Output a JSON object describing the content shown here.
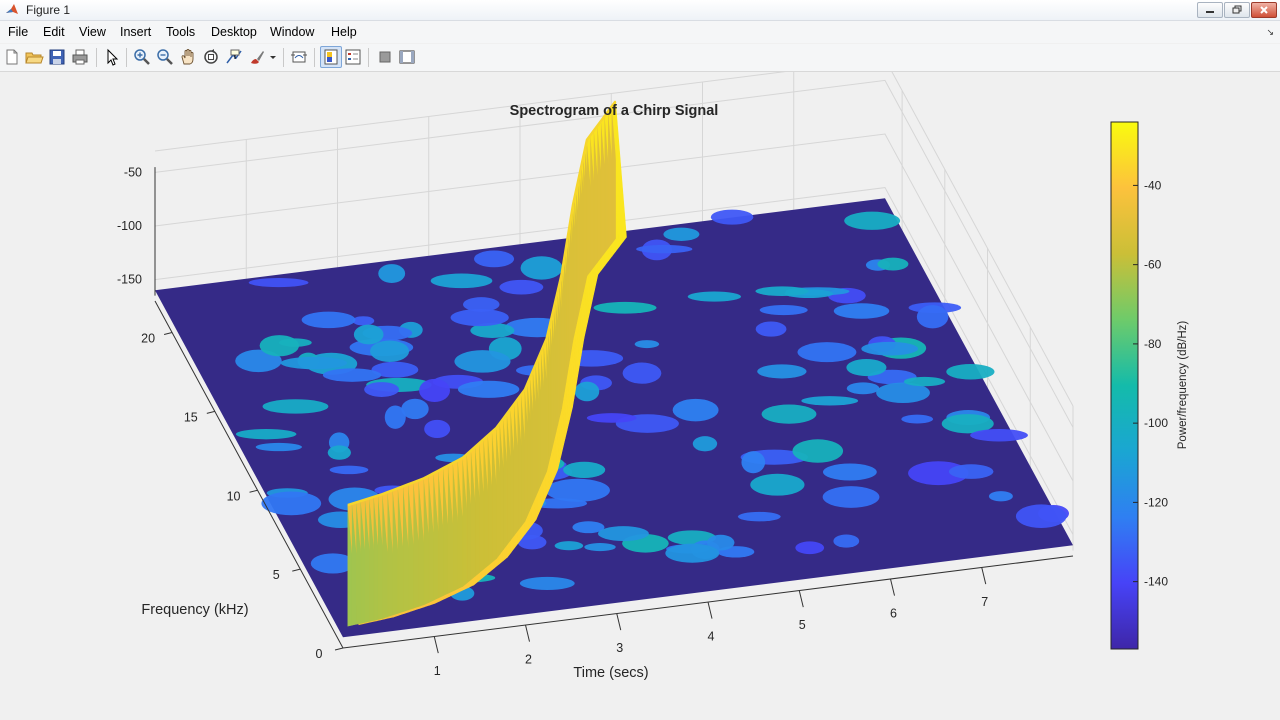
{
  "window": {
    "title": "Figure 1",
    "controls": [
      "minimize",
      "restore",
      "close"
    ]
  },
  "menu": [
    "File",
    "Edit",
    "View",
    "Insert",
    "Tools",
    "Desktop",
    "Window",
    "Help"
  ],
  "toolbar": [
    "new-figure",
    "open-file",
    "save-figure",
    "print-figure",
    "edit-plot",
    "zoom-in",
    "zoom-out",
    "pan",
    "rotate-3d",
    "data-cursor",
    "brush",
    "link-plot",
    "insert-colorbar",
    "insert-legend",
    "hide-plot-tools",
    "show-plot-tools"
  ],
  "colors": {
    "colormap": [
      "#3e26a8",
      "#4743f7",
      "#2f7ff2",
      "#1aa6d2",
      "#14bbaa",
      "#6ecb6a",
      "#cbbf37",
      "#fcc23c",
      "#f9fb0e"
    ],
    "surface_low": "#352a87",
    "ridge": "#f6d62d"
  },
  "chart_data": {
    "type": "surface",
    "title": "Spectrogram of a Chirp Signal",
    "xlabel": "Time (secs)",
    "ylabel": "Frequency (kHz)",
    "zlabel": "",
    "colorbar_label": "Power/frequency (dB/Hz)",
    "xlim": [
      0,
      8
    ],
    "ylim": [
      0,
      22
    ],
    "zlim": [
      -170,
      -30
    ],
    "xticks": [
      "1",
      "2",
      "3",
      "4",
      "5",
      "6",
      "7"
    ],
    "yticks": [
      "0",
      "5",
      "10",
      "15",
      "20"
    ],
    "zticks": [
      "-50",
      "-100",
      "-150"
    ],
    "colorbar_ticks": [
      "-40",
      "-60",
      "-80",
      "-100",
      "-120",
      "-140"
    ],
    "colorbar_range": [
      -157,
      -24
    ],
    "ridge": {
      "name": "",
      "time": [
        0.1,
        0.5,
        1.0,
        1.5,
        2.0,
        2.5,
        3.0,
        3.5,
        4.0,
        4.5,
        5.0
      ],
      "frequency": [
        0.5,
        0.7,
        1.2,
        2.0,
        3.4,
        5.4,
        8.2,
        11.8,
        15.8,
        19.5,
        21.5
      ],
      "power": [
        -45,
        -42,
        -40,
        -38,
        -36,
        -35,
        -34,
        -33,
        -32,
        -31,
        -30
      ]
    },
    "grid": true
  }
}
